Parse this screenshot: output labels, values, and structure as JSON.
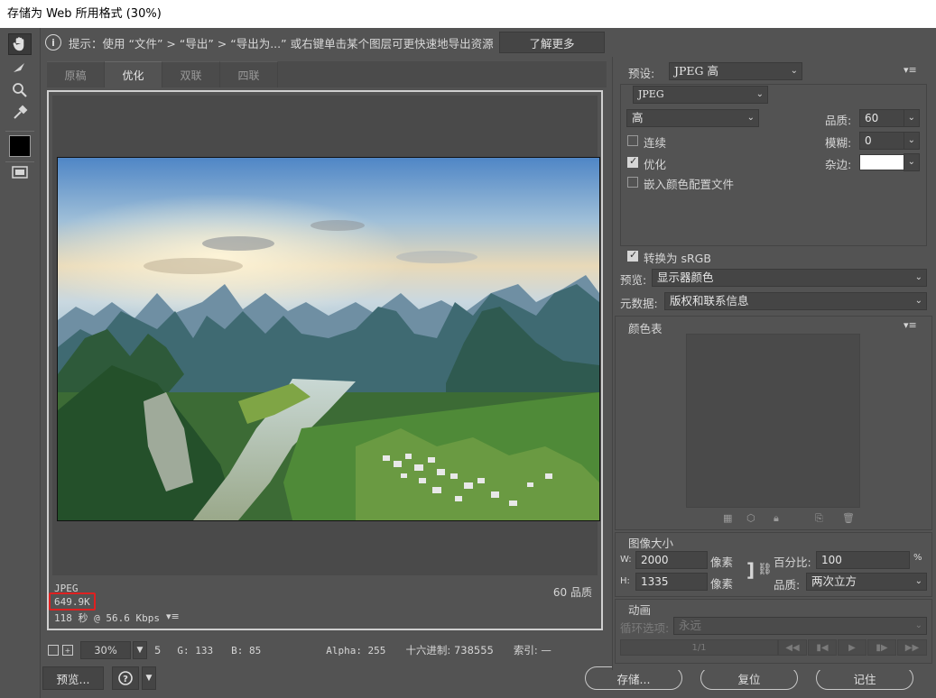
{
  "window": {
    "title": "存储为 Web 所用格式 (30%)"
  },
  "hint": {
    "text": "提示：使用 “文件” > “导出” > “导出为...” 或右键单击某个图层可更快速地导出资源",
    "learn_more": "了解更多"
  },
  "tabs": [
    {
      "label": "原稿",
      "active": false
    },
    {
      "label": "优化",
      "active": true
    },
    {
      "label": "双联",
      "active": false
    },
    {
      "label": "四联",
      "active": false
    }
  ],
  "preview_info": {
    "format": "JPEG",
    "file_size": "649.9K",
    "download_time": "118 秒 @ 56.6 Kbps",
    "quality": "60 品质"
  },
  "statusbar": {
    "zoom": "30%",
    "r": "5",
    "g": "G: 133",
    "b": "B: 85",
    "alpha": "Alpha: 255",
    "hex": "十六进制: 738555",
    "index": "索引: —"
  },
  "buttons": {
    "preview": "预览...",
    "save": "存储...",
    "reset": "复位",
    "remember": "记住"
  },
  "settings": {
    "preset_label": "预设:",
    "preset_value": "JPEG 高",
    "format_value": "JPEG",
    "quality_level": "高",
    "quality_label": "品质:",
    "quality_value": "60",
    "progressive_label": "连续",
    "progressive_checked": false,
    "blur_label": "模糊:",
    "blur_value": "0",
    "optimized_label": "优化",
    "optimized_checked": true,
    "matte_label": "杂边:",
    "matte_color": "#ffffff",
    "embed_profile_label": "嵌入颜色配置文件",
    "embed_profile_checked": false,
    "convert_srgb_label": "转换为 sRGB",
    "convert_srgb_checked": true,
    "preview_label": "预览:",
    "preview_value": "显示器颜色",
    "metadata_label": "元数据:",
    "metadata_value": "版权和联系信息"
  },
  "color_table": {
    "label": "颜色表"
  },
  "image_size": {
    "label": "图像大小",
    "w_label": "W:",
    "w_value": "2000",
    "h_label": "H:",
    "h_value": "1335",
    "unit": "像素",
    "percent_label": "百分比:",
    "percent_value": "100",
    "percent_unit": "%",
    "quality_label": "品质:",
    "quality_value": "两次立方"
  },
  "animation": {
    "label": "动画",
    "loop_label": "循环选项:",
    "loop_value": "永远",
    "frame": "1/1"
  }
}
